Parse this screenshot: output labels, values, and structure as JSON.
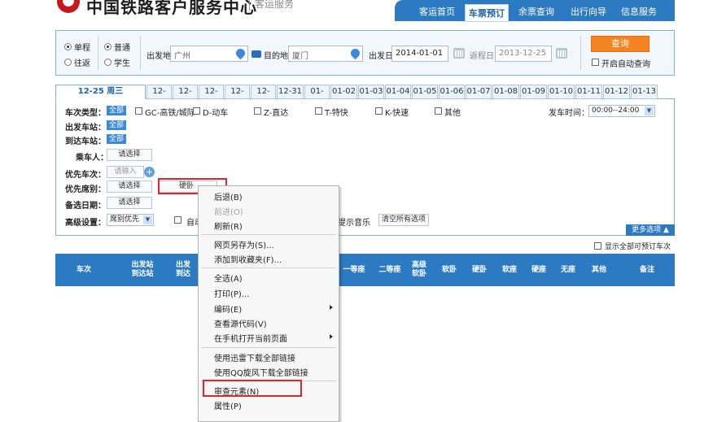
{
  "header": {
    "site_title": "中国铁路客户服务中心",
    "site_subtitle": "客运服务",
    "nav": [
      "客运首页",
      "车票预订",
      "余票查询",
      "出行向导",
      "信息服务"
    ],
    "active_nav": 1
  },
  "search": {
    "trip_types": [
      "单程",
      "往返"
    ],
    "ticket_types": [
      "普通",
      "学生"
    ],
    "from_label": "出发地",
    "from_value": "广州",
    "to_label": "目的地",
    "to_value": "厦门",
    "depart_label": "出发日",
    "depart_value": "2014-01-01",
    "return_label": "返程日",
    "return_value": "2013-12-25",
    "query_button": "查询",
    "auto_query_label": "开启自动查询"
  },
  "date_tabs": [
    "12-25 周三",
    "12-26",
    "12-27",
    "12-28",
    "12-29",
    "12-30",
    "12-31",
    "01-01",
    "01-02",
    "01-03",
    "01-04",
    "01-05",
    "01-06",
    "01-07",
    "01-08",
    "01-09",
    "01-10",
    "01-11",
    "01-12",
    "01-13"
  ],
  "filters": {
    "train_type_label": "车次类型：",
    "all_badge": "全部",
    "train_types": [
      "GC-高铁/城际",
      "D-动车",
      "Z-直达",
      "T-特快",
      "K-快速",
      "其他"
    ],
    "depart_time_label": "发车时间：",
    "depart_time_value": "00:00--24:00",
    "from_station_label": "出发车站：",
    "to_station_label": "到达车站：",
    "passenger_label": "乘车人：",
    "priority_train_label": "优先车次：",
    "priority_seat_label": "优先席别：",
    "backup_date_label": "备选日期：",
    "advanced_label": "高级设置：",
    "select_button": "请选择",
    "input_placeholder": "请输入",
    "seat_tag": "硬卧",
    "advanced_value": "席别优先",
    "auto_label": "自动",
    "music_label": "提示音乐",
    "clear_button": "清空所有选项",
    "more_options": "更多选项 ▲",
    "show_all_label": "显示全部可预订车次"
  },
  "result_columns": [
    "车次",
    "出发站\n到达站",
    "出发\n到达",
    "一等座",
    "二等座",
    "高级\n软卧",
    "软卧",
    "硬卧",
    "软座",
    "硬座",
    "无座",
    "其他",
    "备注"
  ],
  "context_menu": {
    "items": [
      {
        "label": "后退(B)",
        "disabled": false
      },
      {
        "label": "前进(O)",
        "disabled": true
      },
      {
        "label": "刷新(R)",
        "disabled": false
      },
      {
        "label": "网页另存为(S)...",
        "disabled": false
      },
      {
        "label": "添加到收藏夹(F)...",
        "disabled": false
      },
      {
        "label": "全选(A)",
        "disabled": false
      },
      {
        "label": "打印(P)...",
        "disabled": false
      },
      {
        "label": "编码(E)",
        "disabled": false
      },
      {
        "label": "查看源代码(V)",
        "disabled": false
      },
      {
        "label": "在手机打开当前页面",
        "disabled": false
      },
      {
        "label": "使用迅雷下载全部链接",
        "disabled": false
      },
      {
        "label": "使用QQ旋风下载全部链接",
        "disabled": false
      },
      {
        "label": "审查元素(N)",
        "disabled": false
      },
      {
        "label": "属性(P)",
        "disabled": false
      }
    ]
  },
  "colors": {
    "brand_blue": "#2c7ac2",
    "accent_orange": "#f48421",
    "highlight_red": "#e0262c",
    "logo_red": "#c8161d"
  }
}
